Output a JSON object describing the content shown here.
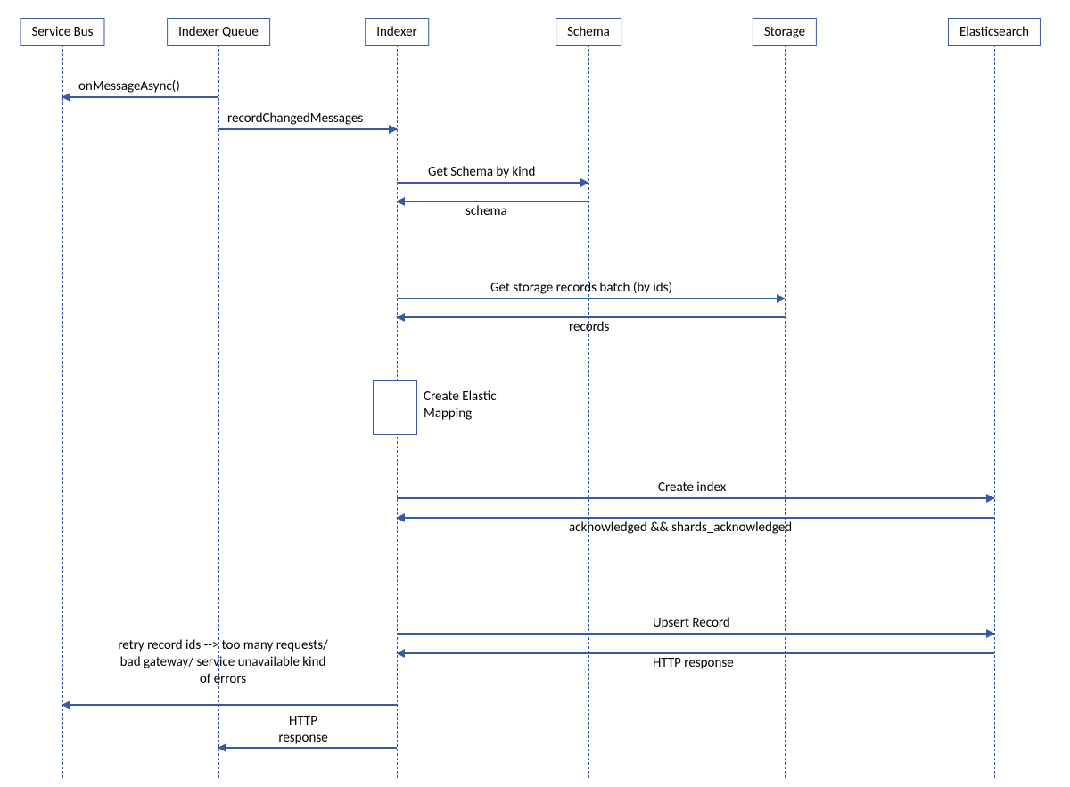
{
  "participants": {
    "serviceBus": "Service Bus",
    "indexerQueue": "Indexer Queue",
    "indexer": "Indexer",
    "schema": "Schema",
    "storage": "Storage",
    "elasticsearch": "Elasticsearch"
  },
  "messages": {
    "onMessageAsync": "onMessageAsync()",
    "recordChangedMessages": "recordChangedMessages",
    "getSchema": "Get Schema by kind",
    "schemaReturn": "schema",
    "getStorage": "Get storage records batch (by ids)",
    "recordsReturn": "records",
    "createElasticMapping": "Create Elastic\nMapping",
    "createIndex": "Create index",
    "ackShards": "acknowledged && shards_acknowledged",
    "upsertRecord": "Upsert Record",
    "httpResponse1": "HTTP response",
    "retryErrors": "retry record ids --> too many requests/\nbad gateway/ service unavailable kind\nof errors",
    "httpResponse2": "HTTP\nresponse"
  },
  "layout": {
    "lanes": {
      "serviceBus": 70,
      "indexerQueue": 245,
      "indexer": 445,
      "schema": 660,
      "storage": 880,
      "elasticsearch": 1115
    }
  }
}
